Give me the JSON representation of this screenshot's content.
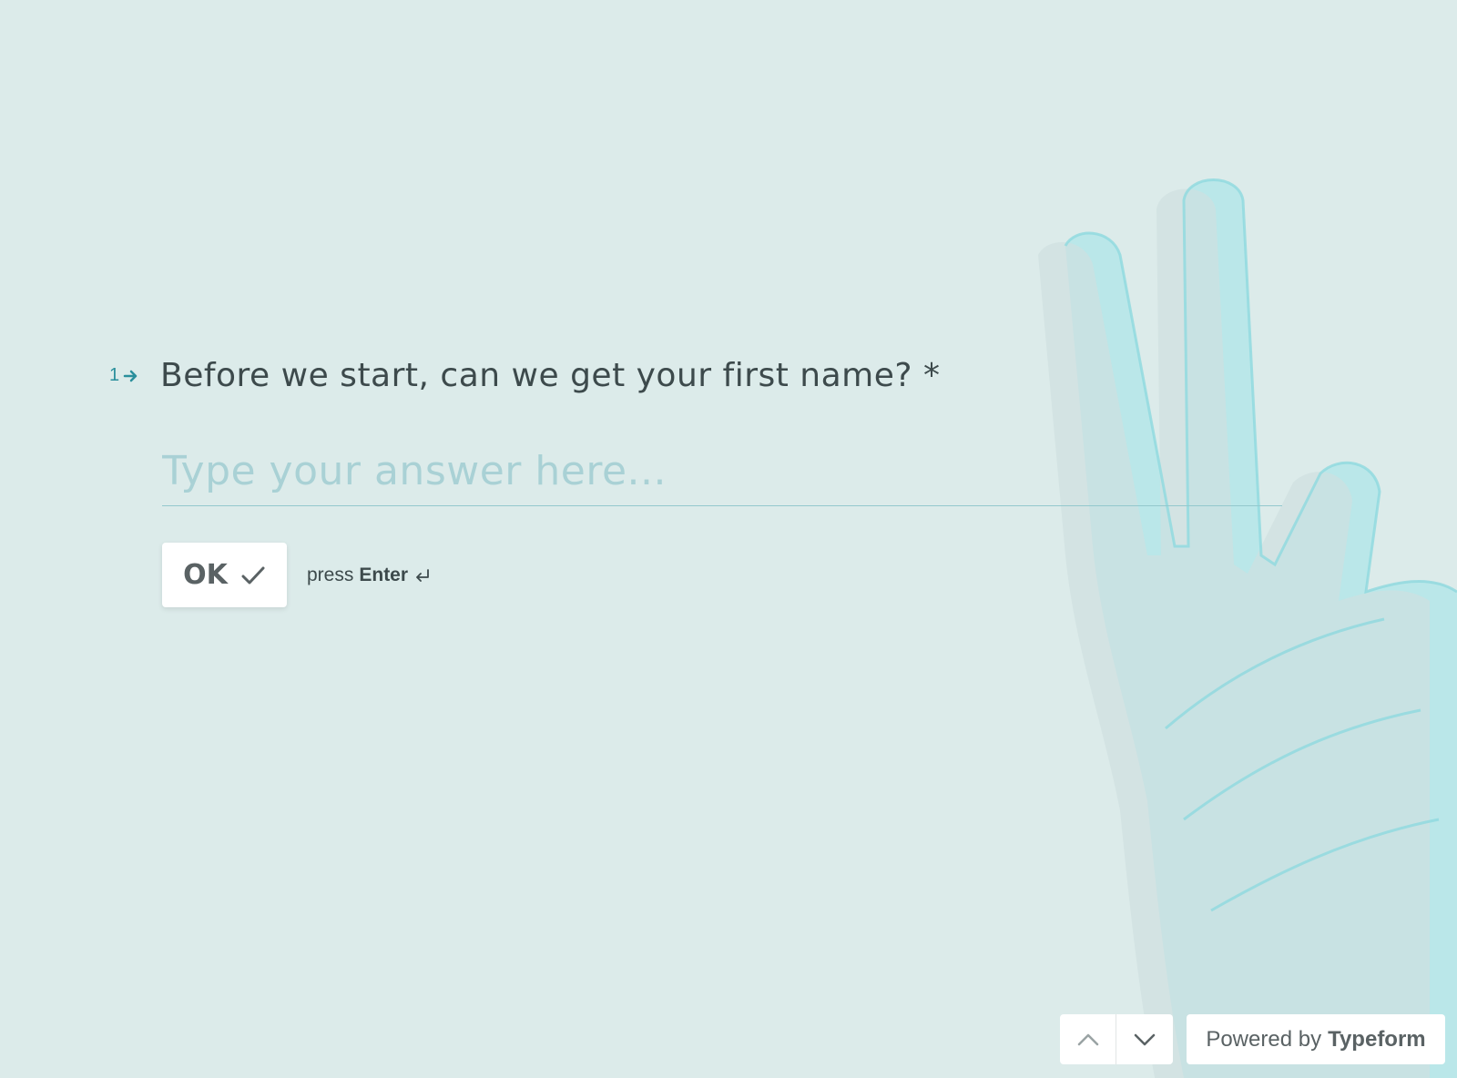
{
  "question": {
    "number": "1",
    "text": "Before we start, can we get your first name? *"
  },
  "answer": {
    "placeholder": "Type your answer here...",
    "value": ""
  },
  "ok_button": {
    "label": "OK"
  },
  "hint": {
    "prefix": "press",
    "key": "Enter"
  },
  "footer": {
    "powered_prefix": "Powered by",
    "powered_brand": "Typeform"
  },
  "colors": {
    "background": "#dcebea",
    "accent": "#2a8f9c",
    "placeholder": "#a9d1d5"
  },
  "icons": [
    "arrow-right-icon",
    "checkmark-icon",
    "enter-key-icon",
    "chevron-up-icon",
    "chevron-down-icon",
    "hand-illustration"
  ]
}
